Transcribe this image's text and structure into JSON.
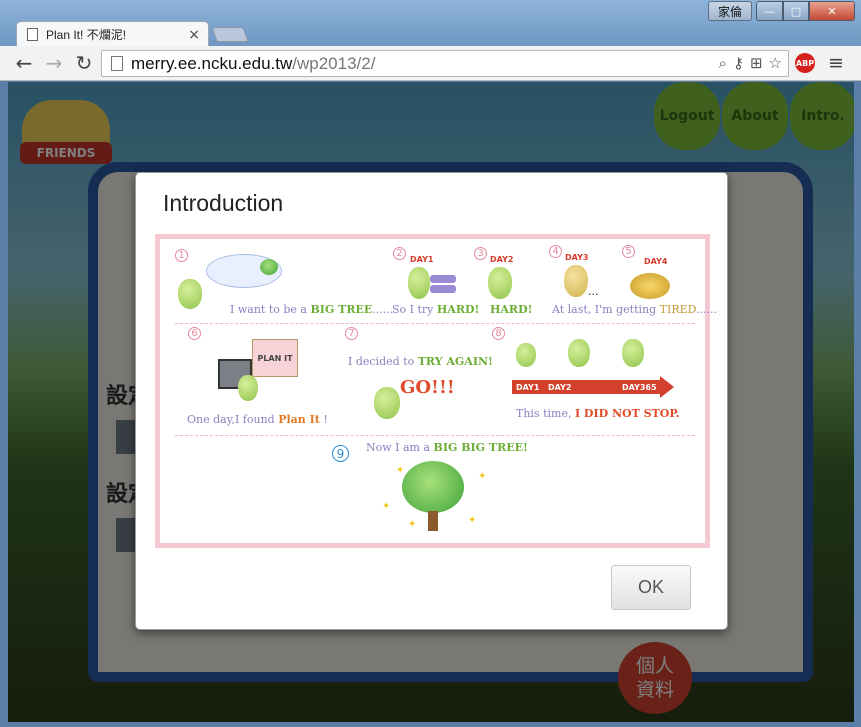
{
  "browser": {
    "tab_title": "Plan It! 不爛泥!",
    "tab_close": "×",
    "user_badge": "家倫",
    "win_min": "—",
    "win_max": "□",
    "win_close": "✕",
    "url_host": "merry.ee.ncku.edu.tw",
    "url_path": "/wp2013/2/",
    "abp_label": "ABP",
    "back": "←",
    "forward": "→",
    "reload": "↻",
    "menu": "≡",
    "zoom_icon": "⌕",
    "key_icon": "⚷",
    "translate_icon": "⊞",
    "star_icon": "☆"
  },
  "site": {
    "friends_label": "FRIENDS",
    "nav": [
      "Logout",
      "About",
      "Intro."
    ],
    "form_label_1": "設定",
    "form_label_2": "設定",
    "profile_badge": "個人\n資料"
  },
  "modal": {
    "title": "Introduction",
    "ok_label": "OK",
    "steps": [
      {
        "num": "1",
        "caption_a": "I want to be a ",
        "caption_b": "BIG TREE",
        "caption_c": "......"
      },
      {
        "num": "2",
        "day": "DAY1",
        "caption_a": "So I try ",
        "caption_b": "HARD!"
      },
      {
        "num": "3",
        "day": "DAY2",
        "caption_b": "HARD!"
      },
      {
        "num": "4",
        "day": "DAY3"
      },
      {
        "num": "5",
        "day": "DAY4",
        "caption_a": "At last, I'm getting ",
        "caption_b": "TIRED",
        "caption_c": "......"
      },
      {
        "num": "6",
        "caption_a": "One day,I found ",
        "caption_b": "Plan It",
        "caption_c": " !",
        "sign": "PLAN IT"
      },
      {
        "num": "7",
        "caption_a": "I decided to ",
        "caption_b": "TRY AGAIN!",
        "go": "GO!!!"
      },
      {
        "num": "8",
        "caption_a": "This time, ",
        "caption_b": "I DID NOT STOP.",
        "arrow_days": [
          "DAY1",
          "DAY2",
          "DAY365"
        ]
      },
      {
        "num": "9",
        "caption_a": "Now I am a ",
        "caption_b": "BIG BIG TREE!"
      }
    ],
    "ellipsis": "...",
    "sparkle": "✦"
  }
}
